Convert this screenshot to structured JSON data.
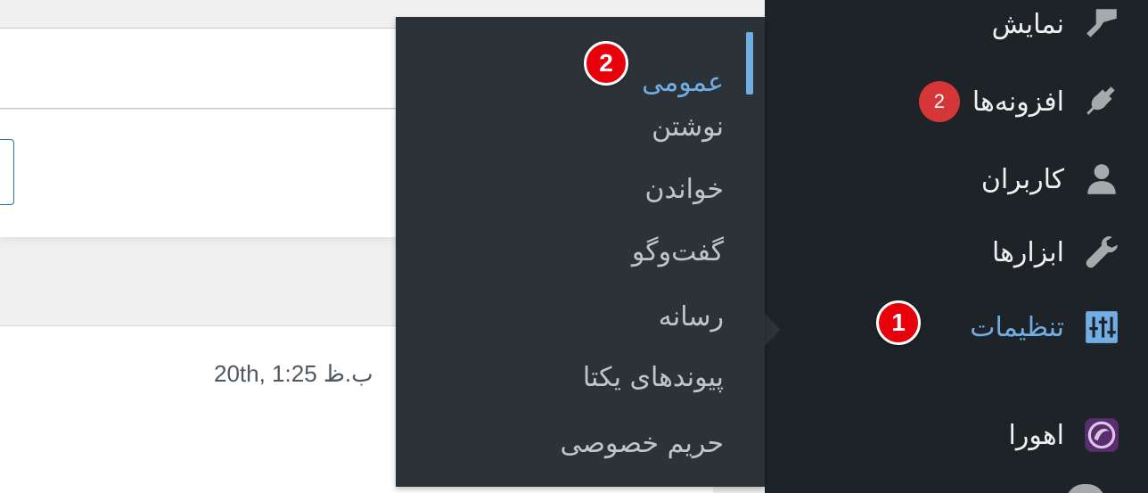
{
  "background": {
    "date_text": "20th, 1:25 ب.ظ"
  },
  "sidebar": {
    "items": [
      {
        "label": "نمایش",
        "icon": "appearance-brush-icon",
        "current": false
      },
      {
        "label": "افزونه‌ها",
        "icon": "plugins-plug-icon",
        "badge": "2",
        "current": false
      },
      {
        "label": "کاربران",
        "icon": "users-person-icon",
        "current": false
      },
      {
        "label": "ابزارها",
        "icon": "tools-wrench-icon",
        "current": false
      },
      {
        "label": "تنظیمات",
        "icon": "settings-sliders-icon",
        "current": true,
        "step": "1"
      },
      {
        "label": "اهورا",
        "icon": "ahura-logo-icon",
        "current": false
      }
    ]
  },
  "submenu": {
    "items": [
      {
        "label": "عمومی",
        "current": true,
        "step": "2"
      },
      {
        "label": "نوشتن"
      },
      {
        "label": "خواندن"
      },
      {
        "label": "گفت‌وگو"
      },
      {
        "label": "رسانه"
      },
      {
        "label": "پیوندهای یکتا"
      },
      {
        "label": "حریم خصوصی"
      }
    ]
  },
  "colors": {
    "sidebar_bg": "#1d2327",
    "submenu_bg": "#2c3338",
    "accent": "#72aee6",
    "update_badge": "#d63638",
    "step_badge": "#e8000b"
  }
}
